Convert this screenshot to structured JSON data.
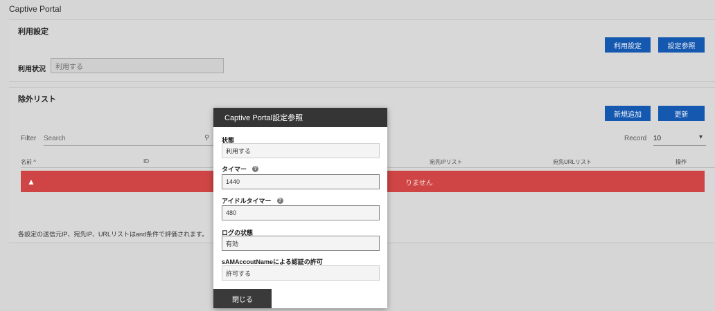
{
  "page": {
    "title": "Captive Portal"
  },
  "usage_panel": {
    "heading": "利用設定",
    "buttons": {
      "usage_settings": "利用設定",
      "view_settings": "設定参照"
    },
    "status_label": "利用状況",
    "status_value": "利用する"
  },
  "exclude_panel": {
    "heading": "除外リスト",
    "buttons": {
      "add_new": "新規追加",
      "update": "更新"
    },
    "filter_label": "Filter",
    "search_placeholder": "Search",
    "record_label": "Record",
    "record_value": "10",
    "columns": {
      "name": "名前 ^",
      "id": "ID",
      "dest_ip": "宛先IPリスト",
      "dest_url": "宛先URLリスト",
      "ops": "操作"
    },
    "alert_text": "りません",
    "footnote": "各設定の送信元IP、宛先IP、URLリストはand条件で評価されます。"
  },
  "modal": {
    "title": "Captive Portal設定参照",
    "fields": [
      {
        "label": "状態",
        "value": "利用する",
        "help": false
      },
      {
        "label": "タイマー",
        "value": "1440",
        "help": true
      },
      {
        "label": "アイドルタイマー",
        "value": "480",
        "help": true
      },
      {
        "label": "ログの状態",
        "value": "有効",
        "help": false
      },
      {
        "label": "sAMAccoutNameによる認証の許可",
        "value": "許可する",
        "help": false
      }
    ],
    "close_label": "閉じる"
  },
  "colors": {
    "primary": "#1558b0",
    "alert": "#cf4545",
    "modal_header": "#353535"
  }
}
